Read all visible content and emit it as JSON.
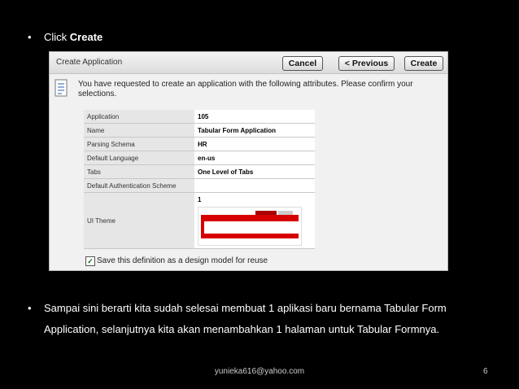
{
  "bullet1": {
    "prefix": "Click ",
    "bold": "Create"
  },
  "screen": {
    "title": "Create Application",
    "buttons": {
      "cancel": "Cancel",
      "previous": "< Previous",
      "create": "Create"
    },
    "message": "You have requested to create an application with the following attributes. Please confirm your selections.",
    "attributes": [
      {
        "label": "Application",
        "value": "105"
      },
      {
        "label": "Name",
        "value": "Tabular Form Application"
      },
      {
        "label": "Parsing Schema",
        "value": "HR"
      },
      {
        "label": "Default Language",
        "value": "en-us"
      },
      {
        "label": "Tabs",
        "value": "One Level of Tabs"
      },
      {
        "label": "Default Authentication Scheme",
        "value": ""
      }
    ],
    "theme": {
      "label": "UI Theme",
      "value": "1"
    },
    "save_label": "Save this definition as a design model for reuse",
    "save_checked": true
  },
  "bullet2": "Sampai sini berarti kita sudah selesai membuat 1 aplikasi baru bernama Tabular Form Application, selanjutnya kita akan menambahkan 1 halaman untuk Tabular Formnya.",
  "footer": {
    "email": "yunieka616@yahoo.com",
    "page": "6"
  },
  "icons": {
    "bullet": "•",
    "check": "✓"
  }
}
